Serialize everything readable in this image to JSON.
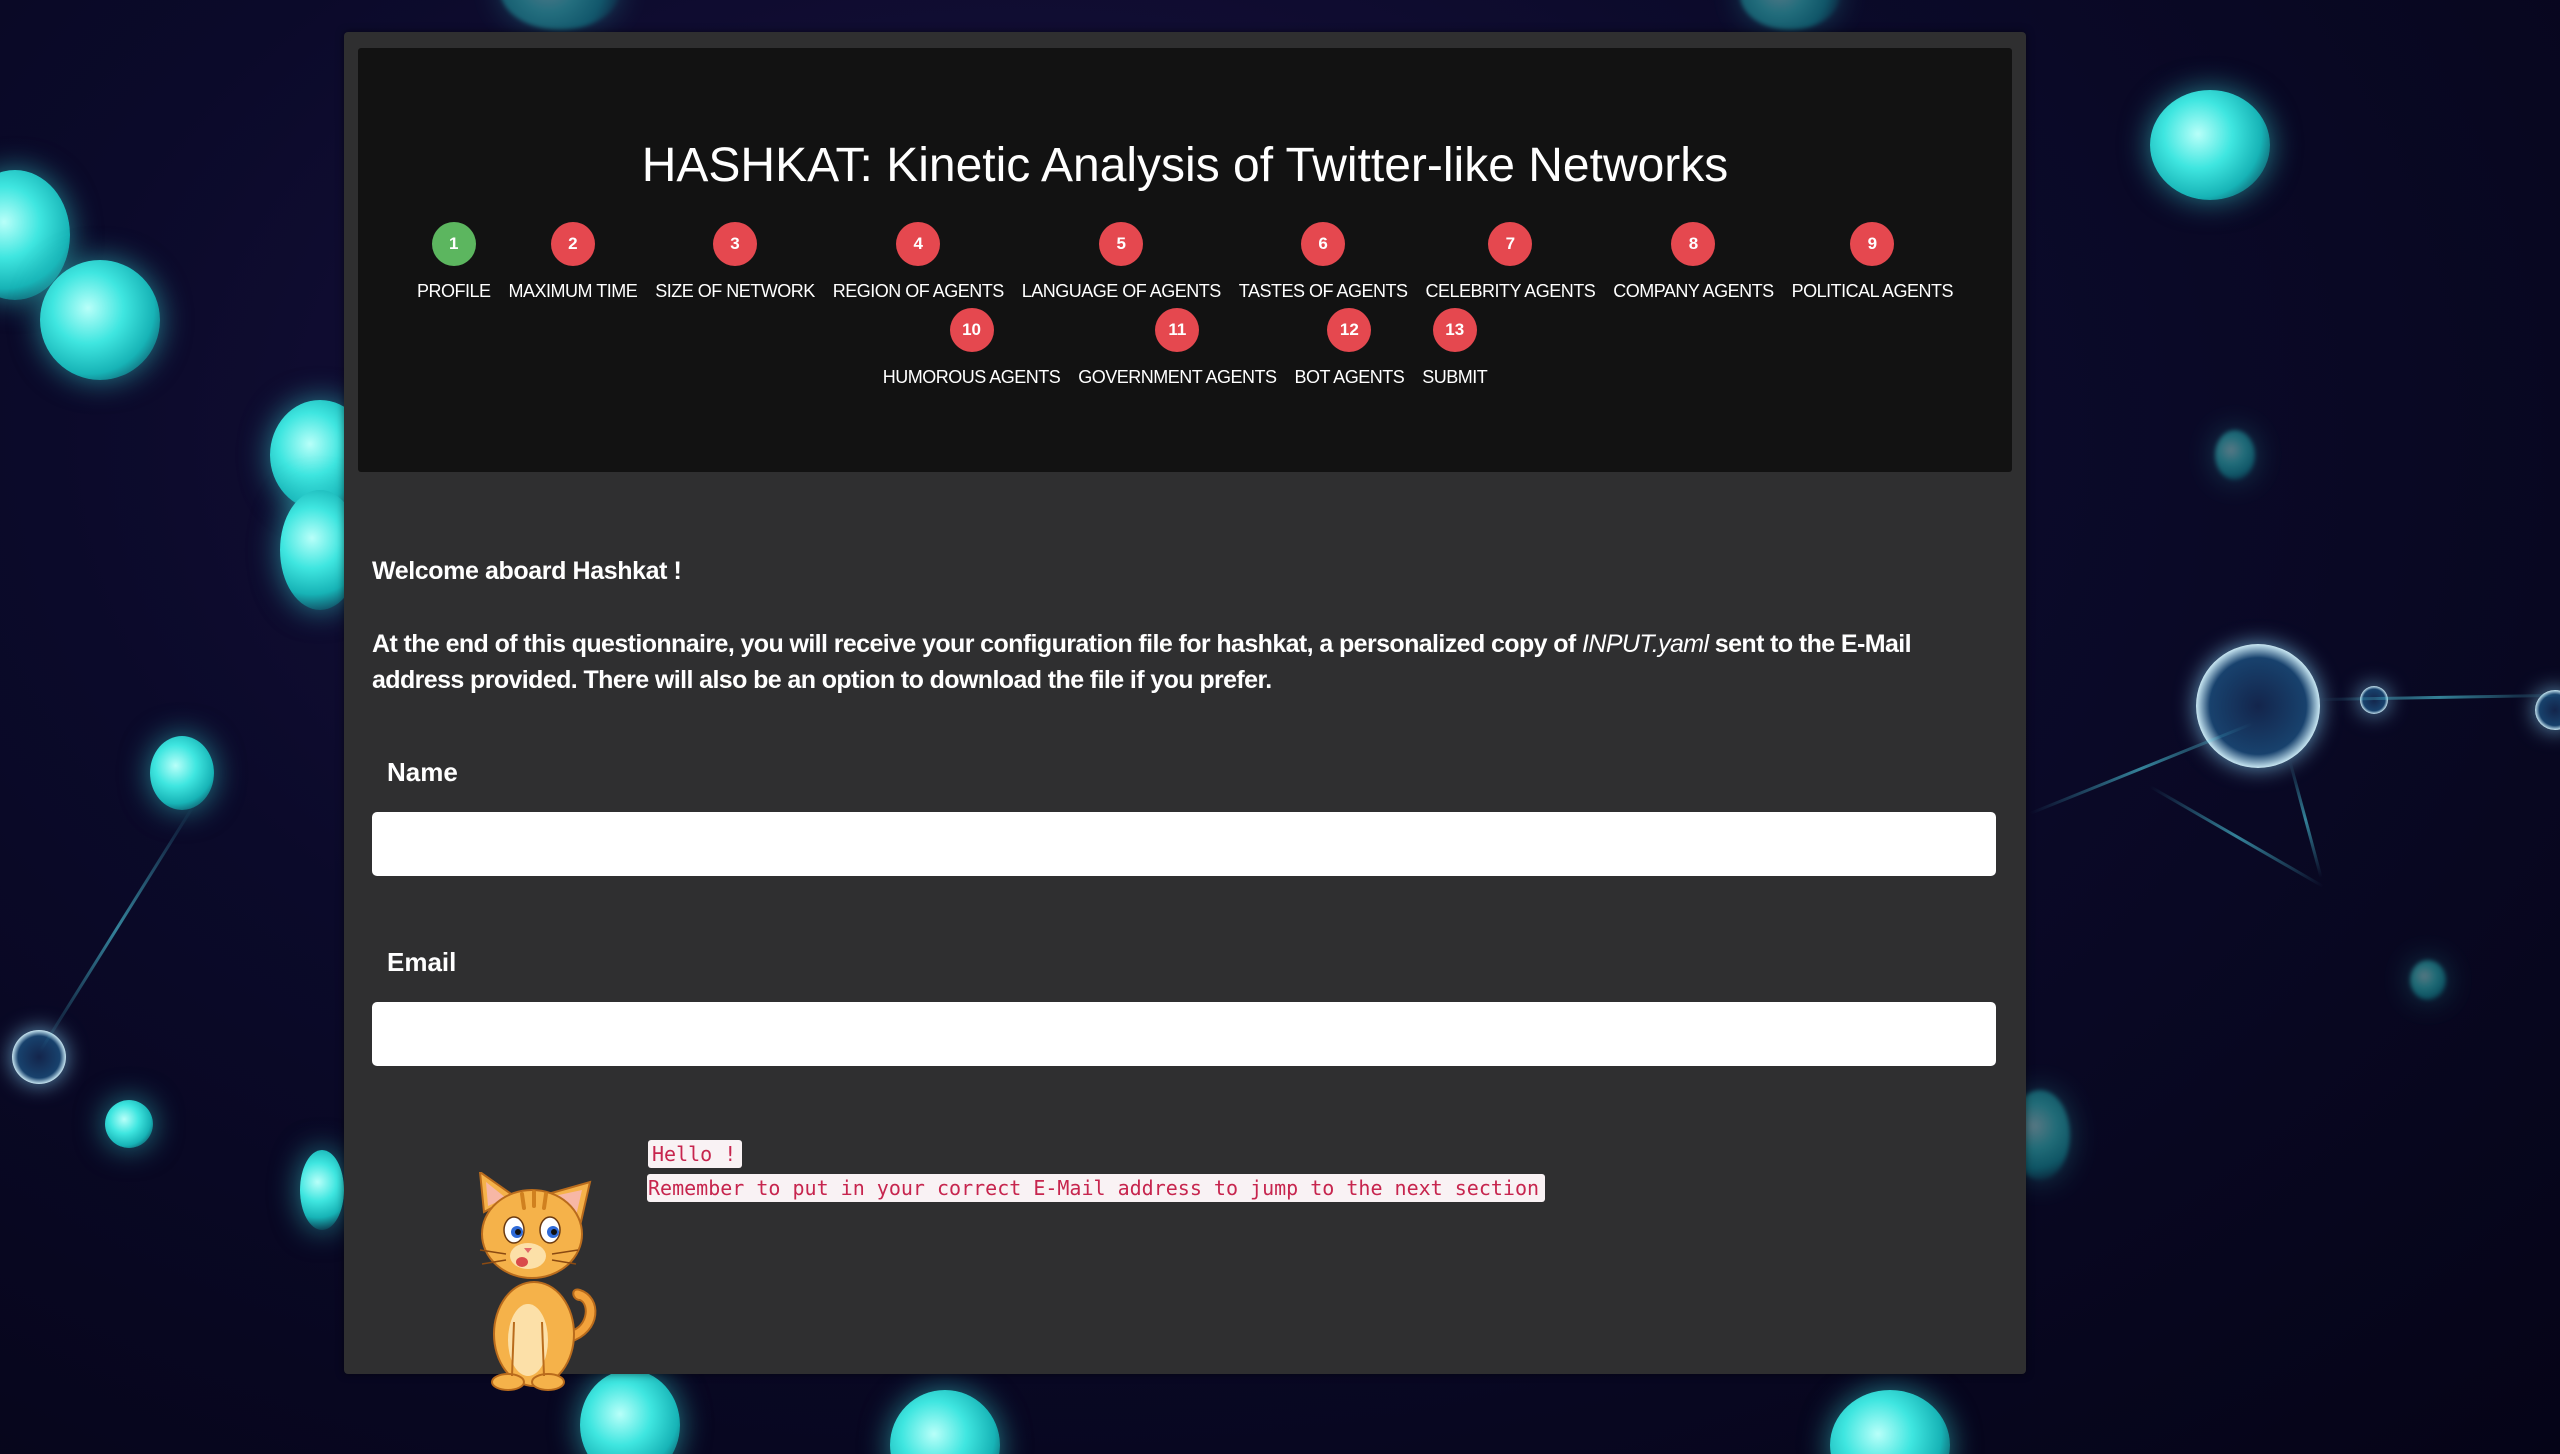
{
  "header": {
    "title": "HASHKAT: Kinetic Analysis of Twitter-like Networks"
  },
  "steps": [
    {
      "num": "1",
      "label": "PROFILE",
      "status": "complete"
    },
    {
      "num": "2",
      "label": "MAXIMUM TIME",
      "status": "pending"
    },
    {
      "num": "3",
      "label": "SIZE OF NETWORK",
      "status": "pending"
    },
    {
      "num": "4",
      "label": "REGION OF AGENTS",
      "status": "pending"
    },
    {
      "num": "5",
      "label": "LANGUAGE OF AGENTS",
      "status": "pending"
    },
    {
      "num": "6",
      "label": "TASTES OF AGENTS",
      "status": "pending"
    },
    {
      "num": "7",
      "label": "CELEBRITY AGENTS",
      "status": "pending"
    },
    {
      "num": "8",
      "label": "COMPANY AGENTS",
      "status": "pending"
    },
    {
      "num": "9",
      "label": "POLITICAL AGENTS",
      "status": "pending"
    },
    {
      "num": "10",
      "label": "HUMOROUS AGENTS",
      "status": "pending"
    },
    {
      "num": "11",
      "label": "GOVERNMENT AGENTS",
      "status": "pending"
    },
    {
      "num": "12",
      "label": "BOT AGENTS",
      "status": "pending"
    },
    {
      "num": "13",
      "label": "SUBMIT",
      "status": "pending"
    }
  ],
  "content": {
    "welcome": "Welcome aboard Hashkat !",
    "intro_before": "At the end of this questionnaire, you will receive your configuration file for hashkat, a personalized copy of ",
    "intro_filename": "INPUT.yaml",
    "intro_after": " sent to the E-Mail address provided. There will also be an option to download the file if you prefer."
  },
  "form": {
    "name_label": "Name",
    "name_value": "",
    "email_label": "Email",
    "email_value": ""
  },
  "mascot": {
    "icon": "cat-mascot-icon",
    "message_line1": "Hello !",
    "message_line2": "Remember to put in your correct E-Mail address to jump to the next section"
  },
  "colors": {
    "step_complete": "#5cb65f",
    "step_pending": "#e5484f",
    "panel_bg": "#2f2f30",
    "header_bg": "#121212",
    "code_text": "#c7254e",
    "code_bg": "#f9f2f4"
  }
}
